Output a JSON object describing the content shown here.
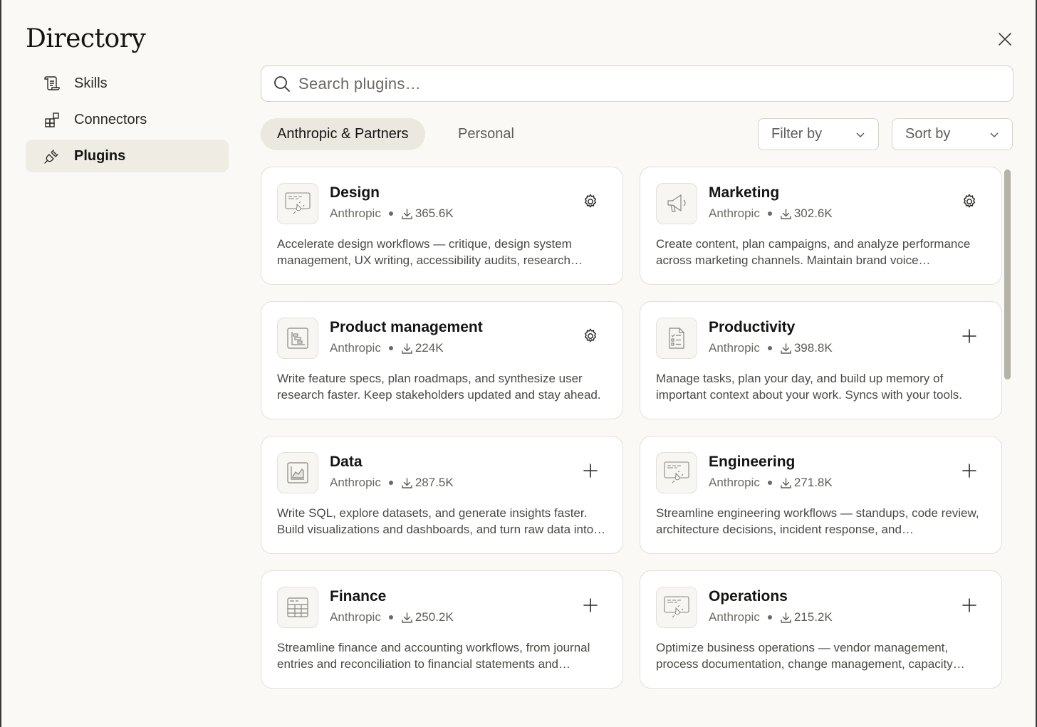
{
  "header": {
    "title": "Directory",
    "close_icon": "close-icon"
  },
  "sidebar": {
    "items": [
      {
        "label": "Skills",
        "icon": "skills-scroll-icon",
        "active": false
      },
      {
        "label": "Connectors",
        "icon": "connectors-blocks-icon",
        "active": false
      },
      {
        "label": "Plugins",
        "icon": "plug-icon",
        "active": true
      }
    ]
  },
  "search": {
    "placeholder": "Search plugins…",
    "value": ""
  },
  "tabs": [
    {
      "label": "Anthropic & Partners",
      "active": true
    },
    {
      "label": "Personal",
      "active": false
    }
  ],
  "filters": {
    "filter_label": "Filter by",
    "sort_label": "Sort by"
  },
  "plugins": [
    {
      "name": "Design",
      "publisher": "Anthropic",
      "downloads": "365.6K",
      "action": "settings",
      "icon": "plug-window-icon",
      "description": "Accelerate design workflows — critique, design system management, UX writing, accessibility audits, research synthesis, and dev handoff."
    },
    {
      "name": "Marketing",
      "publisher": "Anthropic",
      "downloads": "302.6K",
      "action": "settings",
      "icon": "megaphone-icon",
      "description": "Create content, plan campaigns, and analyze performance across marketing channels. Maintain brand voice consistency."
    },
    {
      "name": "Product management",
      "publisher": "Anthropic",
      "downloads": "224K",
      "action": "settings",
      "icon": "roadmap-icon",
      "description": "Write feature specs, plan roadmaps, and synthesize user research faster. Keep stakeholders updated and stay ahead."
    },
    {
      "name": "Productivity",
      "publisher": "Anthropic",
      "downloads": "398.8K",
      "action": "add",
      "icon": "checklist-document-icon",
      "description": "Manage tasks, plan your day, and build up memory of important context about your work. Syncs with your tools."
    },
    {
      "name": "Data",
      "publisher": "Anthropic",
      "downloads": "287.5K",
      "action": "add",
      "icon": "chart-icon",
      "description": "Write SQL, explore datasets, and generate insights faster. Build visualizations and dashboards, and turn raw data into stories."
    },
    {
      "name": "Engineering",
      "publisher": "Anthropic",
      "downloads": "271.8K",
      "action": "add",
      "icon": "plug-window-icon",
      "description": "Streamline engineering workflows — standups, code review, architecture decisions, incident response, and documentation."
    },
    {
      "name": "Finance",
      "publisher": "Anthropic",
      "downloads": "250.2K",
      "action": "add",
      "icon": "spreadsheet-icon",
      "description": "Streamline finance and accounting workflows, from journal entries and reconciliation to financial statements and reporting."
    },
    {
      "name": "Operations",
      "publisher": "Anthropic",
      "downloads": "215.2K",
      "action": "add",
      "icon": "plug-window-icon",
      "description": "Optimize business operations — vendor management, process documentation, change management, capacity planning."
    }
  ]
}
